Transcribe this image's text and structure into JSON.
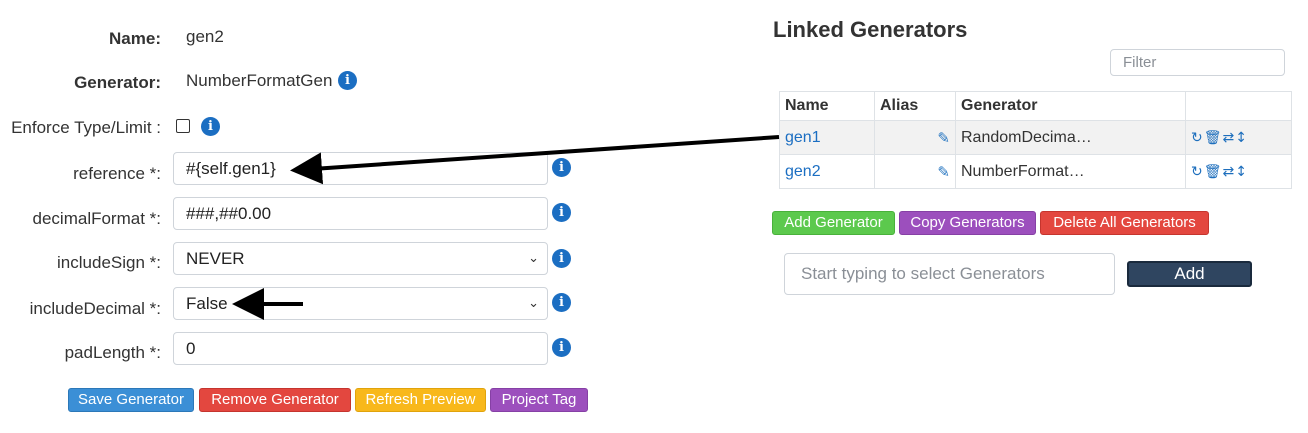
{
  "form": {
    "name_label": "Name:",
    "name_value": "gen2",
    "generator_label": "Generator:",
    "generator_value": "NumberFormatGen",
    "enforce_label": "Enforce Type/Limit :",
    "fields": [
      {
        "label": "reference *:",
        "value": "#{self.gen1}",
        "type": "input"
      },
      {
        "label": "decimalFormat *:",
        "value": "###,##0.00",
        "type": "input"
      },
      {
        "label": "includeSign *:",
        "value": "NEVER",
        "type": "select"
      },
      {
        "label": "includeDecimal *:",
        "value": "False",
        "type": "select"
      },
      {
        "label": "padLength *:",
        "value": "0",
        "type": "input"
      }
    ],
    "info_icon_glyph": "i",
    "buttons": {
      "save": "Save Generator",
      "remove": "Remove Generator",
      "refresh": "Refresh Preview",
      "tag": "Project Tag"
    }
  },
  "linked": {
    "title": "Linked Generators",
    "filter_placeholder": "Filter",
    "columns": [
      "Name",
      "Alias",
      "Generator",
      ""
    ],
    "rows": [
      {
        "name": "gen1",
        "alias": "",
        "generator": "RandomDecima…"
      },
      {
        "name": "gen2",
        "alias": "",
        "generator": "NumberFormat…"
      }
    ],
    "buttons": {
      "add_generator": "Add Generator",
      "copy_generators": "Copy Generators",
      "delete_all": "Delete All Generators"
    },
    "typeahead_placeholder": "Start typing to select Generators",
    "add_label": "Add"
  },
  "icons": {
    "info": "info-circle-icon",
    "pencil": "pencil-icon",
    "row_actions": [
      "repeat-icon",
      "trash-icon",
      "swap-icon",
      "move-vertical-icon"
    ]
  },
  "colors": {
    "primary": "#1b6ec2",
    "green": "#5cc94d",
    "purple": "#9c4fbd",
    "red": "#e3473f",
    "yellow": "#f8b81b",
    "dark_button": "#2f4560"
  }
}
